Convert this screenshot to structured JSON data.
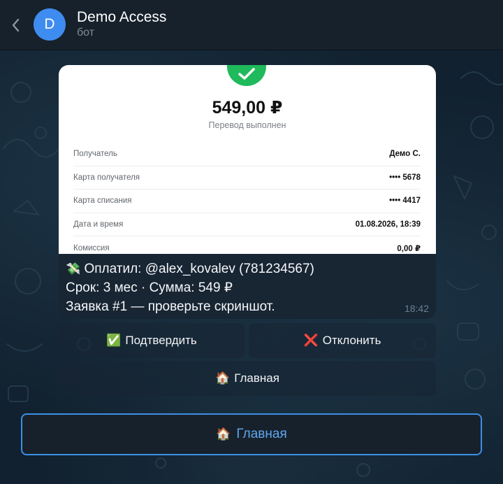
{
  "header": {
    "avatar_letter": "D",
    "title": "Demo Access",
    "subtitle": "бот"
  },
  "receipt": {
    "amount": "549,00 ₽",
    "status": "Перевод выполнен",
    "rows": [
      {
        "label": "Получатель",
        "value": "Демо С."
      },
      {
        "label": "Карта получателя",
        "value": "•••• 5678"
      },
      {
        "label": "Карта списания",
        "value": "•••• 4417"
      },
      {
        "label": "Дата и время",
        "value": "01.08.2026, 18:39"
      },
      {
        "label": "Комиссия",
        "value": "0,00 ₽"
      }
    ]
  },
  "message": {
    "line1_emoji": "💸",
    "line1": "Оплатил: @alex_kovalev (781234567)",
    "line2": "Срок: 3 мес · Сумма: 549 ₽",
    "line3": "Заявка #1 — проверьте скриншот.",
    "time": "18:42"
  },
  "inline_keyboard": {
    "confirm_emoji": "✅",
    "confirm": "Подтвердить",
    "reject_emoji": "❌",
    "reject": "Отклонить",
    "home_emoji": "🏠",
    "home": "Главная"
  },
  "reply_keyboard": {
    "home_emoji": "🏠",
    "home": "Главная"
  },
  "colors": {
    "accent": "#3d8fe6",
    "success": "#1fba5b",
    "avatar": "#3f8cf0"
  }
}
